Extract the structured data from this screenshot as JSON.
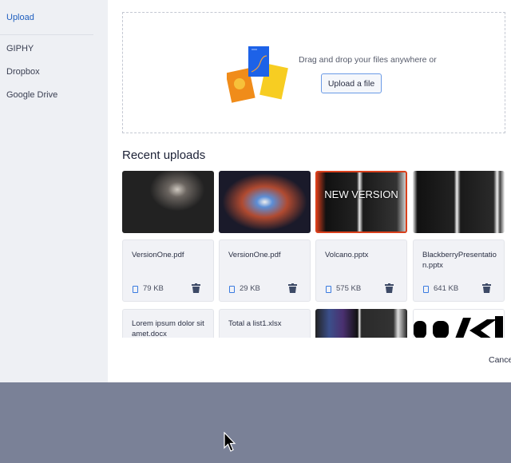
{
  "sidebar": {
    "items": [
      {
        "label": "Upload",
        "active": true
      },
      {
        "label": "GIPHY"
      },
      {
        "label": "Dropbox"
      },
      {
        "label": "Google Drive"
      }
    ]
  },
  "dropzone": {
    "text": "Drag and drop your files anywhere or",
    "button": "Upload a file"
  },
  "recent": {
    "title": "Recent uploads",
    "thumbs": [
      {
        "overlay": ""
      },
      {
        "overlay": ""
      },
      {
        "overlay": "NEW VERSION"
      },
      {
        "overlay": ""
      }
    ],
    "files": [
      {
        "name": "VersionOne.pdf",
        "size": "79 KB"
      },
      {
        "name": "VersionOne.pdf",
        "size": "29 KB"
      },
      {
        "name": "Volcano.pptx",
        "size": "575 KB"
      },
      {
        "name": "BlackberryPresentation.pptx",
        "size": "641 KB"
      }
    ],
    "row3": [
      {
        "name": "Lorem ipsum dolor sit amet.docx"
      },
      {
        "name": "Total a list1.xlsx"
      }
    ]
  },
  "footer": {
    "cancel": "Cancel"
  }
}
